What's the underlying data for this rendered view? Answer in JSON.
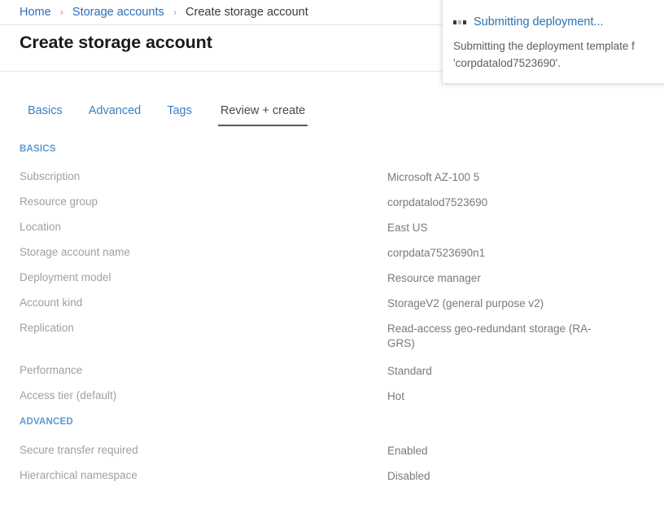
{
  "breadcrumb": {
    "items": [
      {
        "label": "Home",
        "link": true
      },
      {
        "label": "Storage accounts",
        "link": true
      },
      {
        "label": "Create storage account",
        "link": false
      }
    ],
    "separator": "›"
  },
  "page": {
    "title": "Create storage account"
  },
  "tabs": [
    {
      "label": "Basics",
      "active": false
    },
    {
      "label": "Advanced",
      "active": false
    },
    {
      "label": "Tags",
      "active": false
    },
    {
      "label": "Review + create",
      "active": true
    }
  ],
  "sections": [
    {
      "heading": "BASICS",
      "rows": [
        {
          "label": "Subscription",
          "value": "Microsoft AZ-100 5"
        },
        {
          "label": "Resource group",
          "value": "corpdatalod7523690"
        },
        {
          "label": "Location",
          "value": "East US"
        },
        {
          "label": "Storage account name",
          "value": "corpdata7523690n1"
        },
        {
          "label": "Deployment model",
          "value": "Resource manager"
        },
        {
          "label": "Account kind",
          "value": "StorageV2 (general purpose v2)"
        },
        {
          "label": "Replication",
          "value": "Read-access geo-redundant storage (RA-GRS)"
        },
        {
          "label": "Performance",
          "value": "Standard"
        },
        {
          "label": "Access tier (default)",
          "value": "Hot"
        }
      ]
    },
    {
      "heading": "ADVANCED",
      "rows": [
        {
          "label": "Secure transfer required",
          "value": "Enabled"
        },
        {
          "label": "Hierarchical namespace",
          "value": "Disabled"
        }
      ]
    }
  ],
  "notification": {
    "icon": "in-progress-icon",
    "title": "Submitting deployment...",
    "body_line1": "Submitting the deployment template f",
    "body_line2": "'corpdatalod7523690'."
  },
  "colors": {
    "link": "#2c6fb5",
    "tab_inactive": "#3b7fc4",
    "tab_active": "#4a4a4a",
    "section_heading": "#5b9bd5",
    "label": "#a0a0a0",
    "value": "#7a7a7a"
  }
}
